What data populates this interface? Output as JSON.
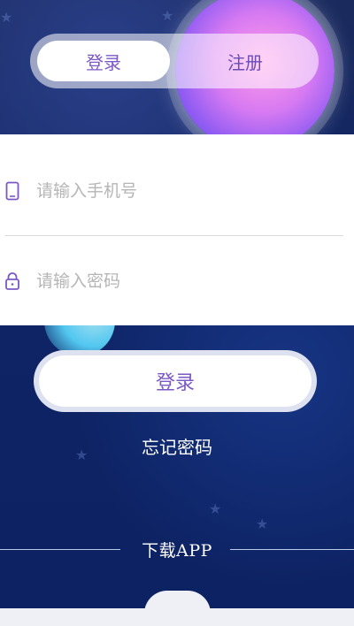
{
  "tabs": {
    "login": "登录",
    "register": "注册"
  },
  "form": {
    "phone_placeholder": "请输入手机号",
    "password_placeholder": "请输入密码"
  },
  "actions": {
    "login_button": "登录",
    "forgot_password": "忘记密码"
  },
  "download": {
    "label": "下载APP"
  },
  "colors": {
    "accent": "#7a58c6",
    "background": "#0f2466",
    "card": "#ffffff"
  },
  "icons": {
    "phone": "phone-icon",
    "lock": "lock-icon"
  }
}
